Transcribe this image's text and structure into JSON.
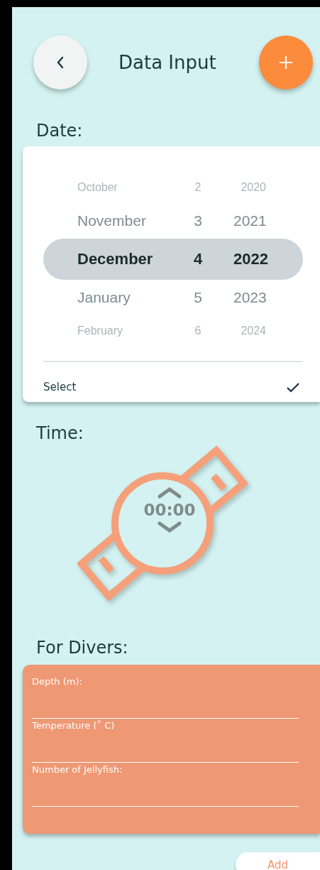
{
  "header": {
    "title": "Data Input"
  },
  "date": {
    "label": "Date:",
    "rows": [
      {
        "month": "October",
        "day": "2",
        "year": "2020",
        "selected": false
      },
      {
        "month": "November",
        "day": "3",
        "year": "2021",
        "selected": false
      },
      {
        "month": "December",
        "day": "4",
        "year": "2022",
        "selected": true
      },
      {
        "month": "January",
        "day": "5",
        "year": "2023",
        "selected": false
      },
      {
        "month": "February",
        "day": "6",
        "year": "2024",
        "selected": false
      }
    ],
    "select_label": "Select"
  },
  "time": {
    "label": "Time:",
    "value": "00:00"
  },
  "divers": {
    "label": "For Divers:",
    "fields": [
      {
        "label": "Depth (m):"
      },
      {
        "label": "Temperature (˚ C)"
      },
      {
        "label": "Number of Jellyfish:"
      }
    ]
  },
  "add_button": "Add"
}
